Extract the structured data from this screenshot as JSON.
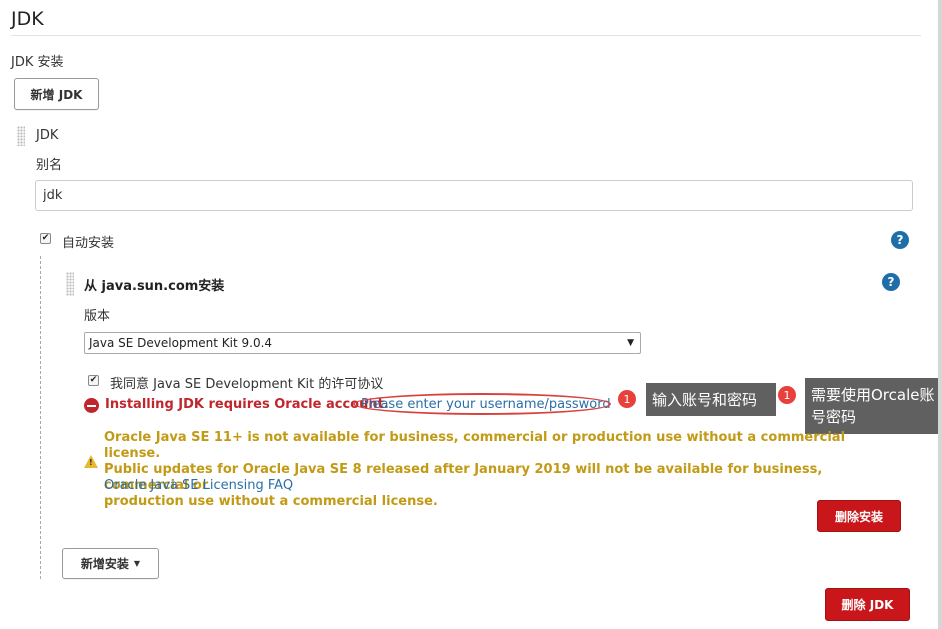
{
  "section": {
    "title": "JDK",
    "subtitle": "JDK 安装"
  },
  "add_jdk_button": "新增 JDK",
  "jdk_item": {
    "label": "JDK",
    "alias_label": "别名",
    "alias_value": "jdk",
    "auto_install_label": "自动安装",
    "auto_install_checked": true
  },
  "installer": {
    "title": "从 java.sun.com安装",
    "version_label": "版本",
    "version_selected": "Java SE Development Kit 9.0.4",
    "agree_label": "我同意 Java SE Development Kit 的许可协议",
    "agree_checked": true,
    "error_text": "Installing JDK requires Oracle account.",
    "error_link": "Please enter your username/password",
    "warning_lines": [
      "Oracle Java SE 11+ is not available for business, commercial or production use without a commercial license.",
      "Public updates for Oracle Java SE 8 released after January 2019 will not be available for business, commercial or",
      "production use without a commercial license."
    ],
    "faq_link": "Oracle Java SE Licensing FAQ",
    "delete_install_button": "删除安装"
  },
  "new_install_button": "新增安装",
  "delete_jdk_button": "删除 JDK",
  "annotations": [
    {
      "badge": "1",
      "text": "输入账号和密码"
    },
    {
      "badge": "1",
      "text": "需要使用Orcale账号密码"
    }
  ],
  "colors": {
    "error": "#c0272d",
    "warning": "#c29a15",
    "link": "#2a6fa8",
    "danger_button": "#c9161b",
    "help": "#1e6fa8"
  }
}
